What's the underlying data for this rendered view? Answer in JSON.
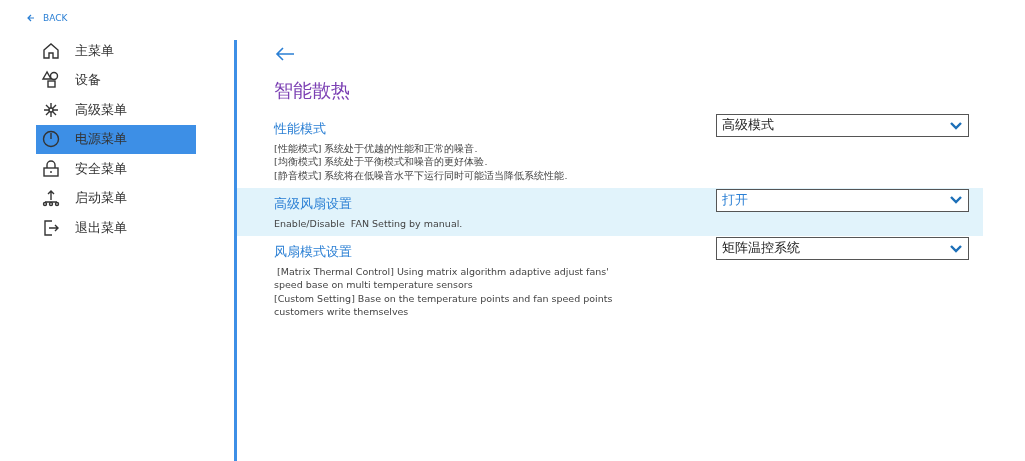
{
  "back": {
    "label": "BACK"
  },
  "sidebar": {
    "items": [
      {
        "label": "主菜单",
        "kind": "home",
        "selected": false
      },
      {
        "label": "设备",
        "kind": "devices",
        "selected": false
      },
      {
        "label": "高级菜单",
        "kind": "advanced",
        "selected": false
      },
      {
        "label": "电源菜单",
        "kind": "power",
        "selected": true
      },
      {
        "label": "安全菜单",
        "kind": "lock",
        "selected": false
      },
      {
        "label": "启动菜单",
        "kind": "boot",
        "selected": false
      },
      {
        "label": "退出菜单",
        "kind": "exit",
        "selected": false
      }
    ]
  },
  "page": {
    "title": "智能散热",
    "settings": [
      {
        "label": "性能模式",
        "description": [
          "[性能模式] 系统处于优越的性能和正常的噪音.",
          "[均衡模式] 系统处于平衡模式和噪音的更好体验.",
          "[静音模式] 系统将在低噪音水平下运行同时可能适当降低系统性能."
        ],
        "value": "高级模式",
        "selected": false
      },
      {
        "label": "高级风扇设置",
        "description": [
          "Enable/Disable  FAN Setting by manual."
        ],
        "value": "打开",
        "selected": true
      },
      {
        "label": "风扇模式设置",
        "description": [
          " [Matrix Thermal Control] Using matrix algorithm adaptive adjust fans'",
          "speed base on multi temperature sensors",
          "[Custom Setting] Base on the temperature points and fan speed points",
          "customers write themselves"
        ],
        "value": "矩阵温控系统",
        "selected": false
      }
    ]
  }
}
